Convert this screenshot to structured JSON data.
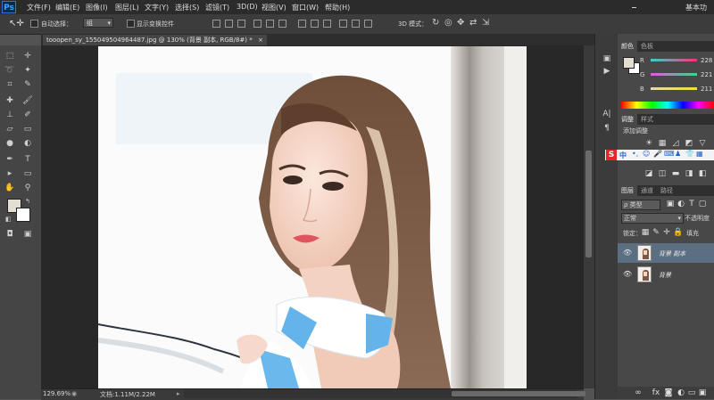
{
  "app": {
    "logo": "Ps",
    "workspace": "基本功"
  },
  "menu": [
    "文件(F)",
    "编辑(E)",
    "图像(I)",
    "图层(L)",
    "文字(Y)",
    "选择(S)",
    "滤镜(T)",
    "3D(D)",
    "视图(V)",
    "窗口(W)",
    "帮助(H)"
  ],
  "options": {
    "auto_select_label": "自动选择：",
    "auto_select_value": "组",
    "show_transform_label": "显示变换控件",
    "mode_3d_label": "3D 模式："
  },
  "document": {
    "tab_title": "tooopen_sy_155049504964487.jpg @ 130% (背景 副本, RGB/8#) *",
    "tab_close": "×"
  },
  "status": {
    "zoom": "129.69%",
    "doc_size": "文档:1.11M/2.22M"
  },
  "color_panel": {
    "tabs": [
      "颜色",
      "色板"
    ],
    "channels": [
      {
        "label": "R",
        "value": "228",
        "color": "#ff2f7a"
      },
      {
        "label": "G",
        "value": "221",
        "color": "#36d98a"
      },
      {
        "label": "B",
        "value": "211",
        "color": "#f0e030"
      }
    ],
    "swatch_fg": "#e4ddd3",
    "swatch_bg": "#ffffff"
  },
  "adjust_panel": {
    "tabs": [
      "调整",
      "样式"
    ],
    "title": "添加调整",
    "ime_text": "中"
  },
  "layers_panel": {
    "tabs": [
      "图层",
      "通道",
      "路径"
    ],
    "filter_value": "ρ 类型",
    "blend_mode": "正常",
    "opacity_label": "不透明度",
    "lock_label": "锁定：",
    "fill_label": "填充",
    "layers": [
      {
        "name": "背景 副本",
        "selected": true
      },
      {
        "name": "背景",
        "selected": false
      }
    ]
  },
  "colors": {
    "accent": "#34a9ff",
    "foreground": "#e4ddd3",
    "background": "#ffffff"
  }
}
